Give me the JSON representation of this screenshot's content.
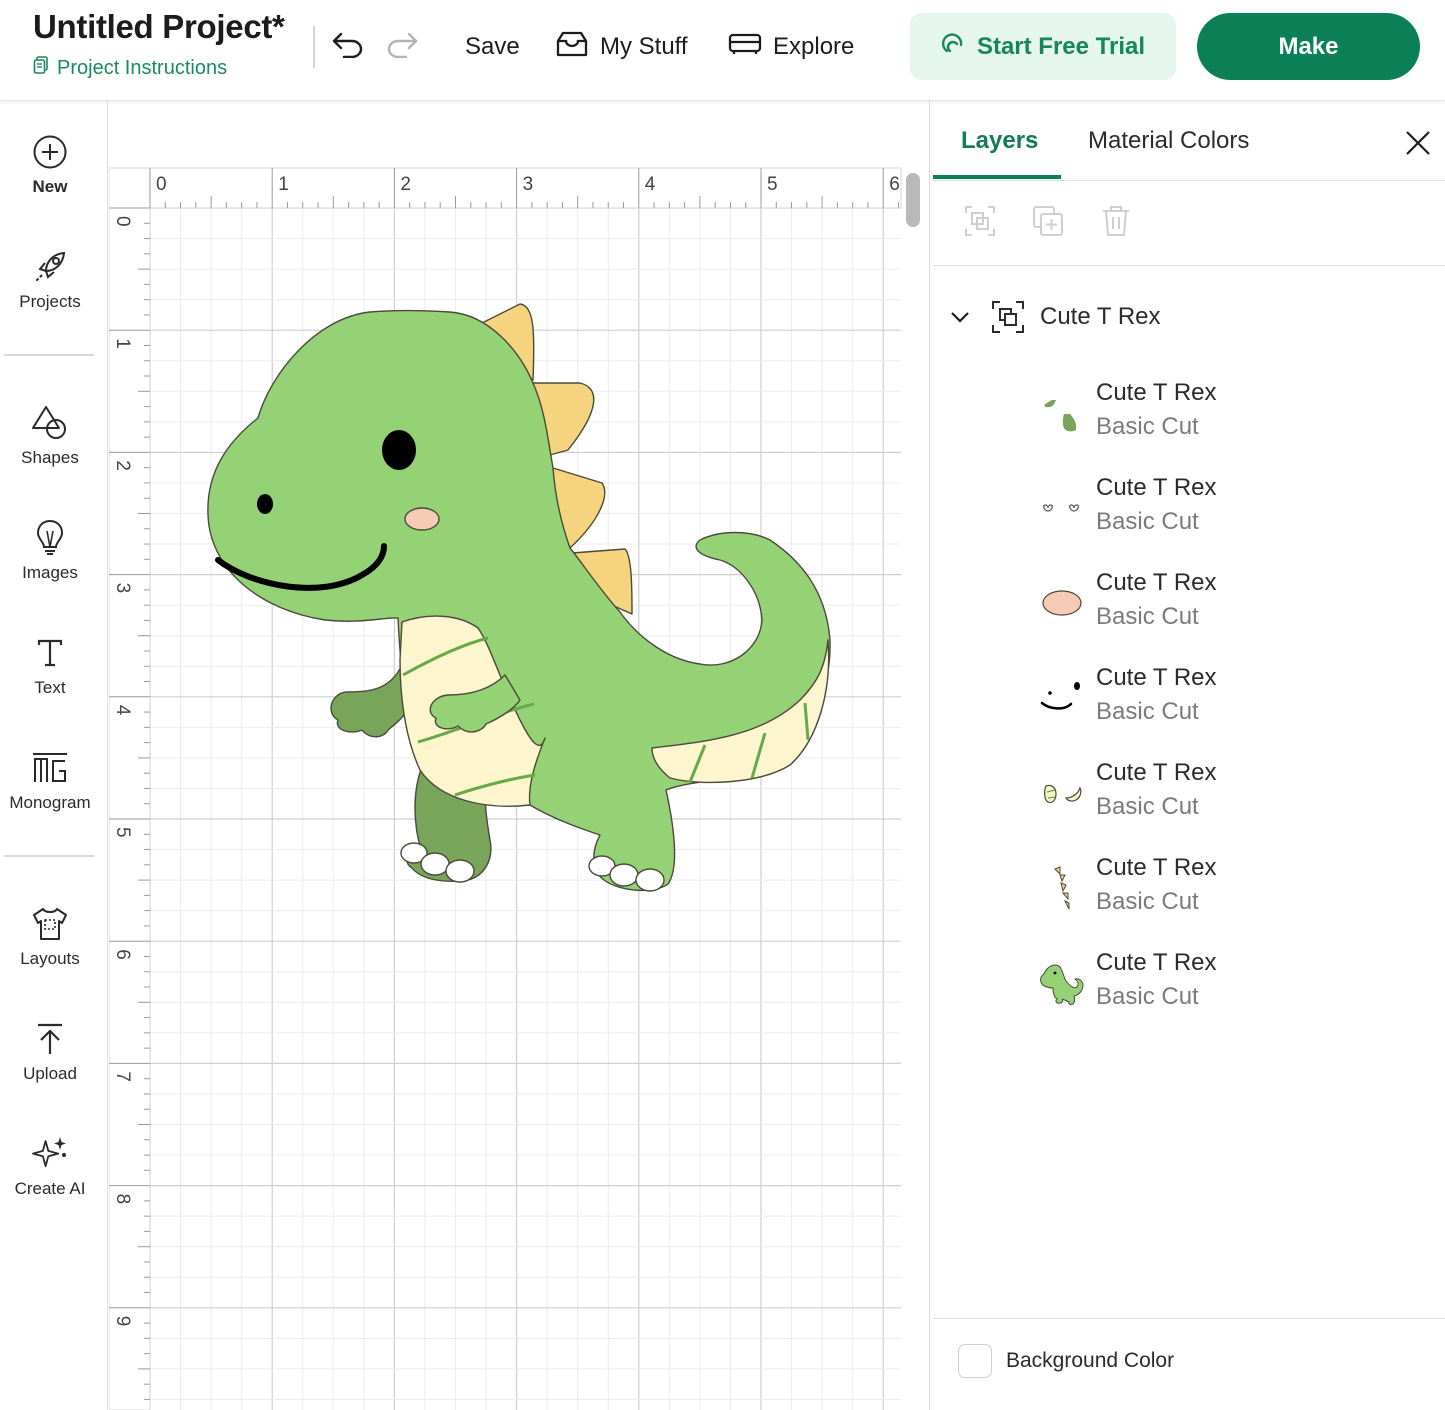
{
  "header": {
    "project_title": "Untitled Project*",
    "project_instructions": "Project Instructions",
    "save_label": "Save",
    "mystuff_label": "My Stuff",
    "explore_label": "Explore",
    "trial_label": "Start Free Trial",
    "make_label": "Make"
  },
  "left_toolbar": {
    "items": [
      {
        "label": "New",
        "icon": "plus-circle-icon"
      },
      {
        "label": "Projects",
        "icon": "rocket-icon"
      },
      {
        "label": "Shapes",
        "icon": "shapes-icon"
      },
      {
        "label": "Images",
        "icon": "lightbulb-icon"
      },
      {
        "label": "Text",
        "icon": "text-icon"
      },
      {
        "label": "Monogram",
        "icon": "monogram-icon"
      },
      {
        "label": "Layouts",
        "icon": "tshirt-icon"
      },
      {
        "label": "Upload",
        "icon": "upload-icon"
      },
      {
        "label": "Create AI",
        "icon": "sparkle-icon"
      }
    ]
  },
  "canvas": {
    "ruler_top": [
      "0",
      "1",
      "2",
      "3",
      "4",
      "5",
      "6"
    ],
    "ruler_left": [
      "0",
      "1",
      "2",
      "3",
      "4",
      "5",
      "6",
      "7",
      "8",
      "9"
    ],
    "image": "Cute T Rex"
  },
  "right_panel": {
    "tabs": [
      "Layers",
      "Material Colors"
    ],
    "active_tab": "Layers",
    "group_name": "Cute T Rex",
    "layers": [
      {
        "name": "Cute T Rex",
        "type": "Basic Cut",
        "thumb": "dark-green-parts"
      },
      {
        "name": "Cute T Rex",
        "type": "Basic Cut",
        "thumb": "claw-outlines"
      },
      {
        "name": "Cute T Rex",
        "type": "Basic Cut",
        "thumb": "pink-cheek"
      },
      {
        "name": "Cute T Rex",
        "type": "Basic Cut",
        "thumb": "black-face"
      },
      {
        "name": "Cute T Rex",
        "type": "Basic Cut",
        "thumb": "cream-parts"
      },
      {
        "name": "Cute T Rex",
        "type": "Basic Cut",
        "thumb": "yellow-spikes"
      },
      {
        "name": "Cute T Rex",
        "type": "Basic Cut",
        "thumb": "green-body"
      }
    ],
    "background_color_label": "Background Color"
  },
  "colors": {
    "brand_green": "#0b7f56",
    "trial_bg": "#e4f6ee",
    "dino_green": "#94d275",
    "dino_dark_green": "#78a55a",
    "spike_yellow": "#f6d37e",
    "belly_cream": "#fdf5cd",
    "cheek_pink": "#f6cbb5"
  }
}
